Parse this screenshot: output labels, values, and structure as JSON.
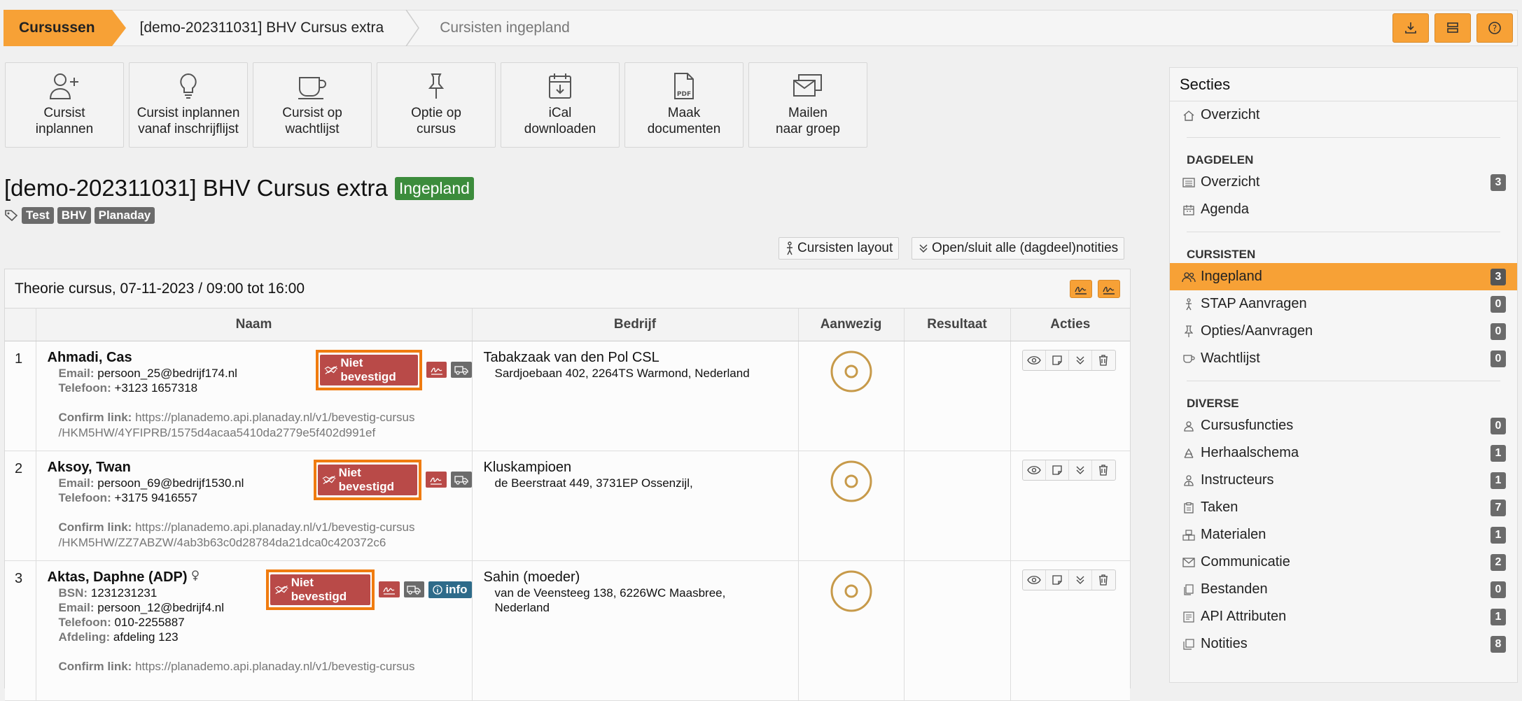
{
  "breadcrumb": {
    "first": "Cursussen",
    "second": "[demo-202311031] BHV Cursus extra",
    "third": "Cursisten ingepland"
  },
  "top_actions": [
    {
      "icon": "download-icon"
    },
    {
      "icon": "layout-icon"
    },
    {
      "icon": "help-icon"
    }
  ],
  "tiles": [
    {
      "label": "Cursist\ninplannen",
      "icon": "add-user-icon"
    },
    {
      "label": "Cursist inplannen\nvanaf inschrijflijst",
      "icon": "lightbulb-icon"
    },
    {
      "label": "Cursist op\nwachtlijst",
      "icon": "coffee-cup-icon"
    },
    {
      "label": "Optie op\ncursus",
      "icon": "pin-icon"
    },
    {
      "label": "iCal\ndownloaden",
      "icon": "calendar-download-icon"
    },
    {
      "label": "Maak\ndocumenten",
      "icon": "pdf-icon"
    },
    {
      "label": "Mailen\nnaar groep",
      "icon": "mail-group-icon"
    }
  ],
  "course": {
    "title": "[demo-202311031] BHV Cursus extra",
    "status": "Ingepland",
    "tags": [
      "Test",
      "BHV",
      "Planaday"
    ]
  },
  "buttons": {
    "layout": "Cursisten layout",
    "toggle_notes": "Open/sluit alle (dagdeel)notities"
  },
  "section": {
    "title": "Theorie cursus, 07-11-2023 / 09:00 tot 16:00",
    "columns": {
      "name": "Naam",
      "company": "Bedrijf",
      "present": "Aanwezig",
      "result": "Resultaat",
      "actions": "Acties"
    },
    "labels": {
      "email": "Email:",
      "phone": "Telefoon:",
      "confirm": "Confirm link:",
      "bsn": "BSN:",
      "department": "Afdeling:"
    },
    "status_label": "Niet bevestigd",
    "info_label": "info",
    "rows": [
      {
        "num": "1",
        "name": "Ahmadi, Cas",
        "email": "persoon_25@bedrijf174.nl",
        "phone": "+3123 1657318",
        "link1": "https://planademo.api.planaday.nl/v1/bevestig-cursus",
        "link2": "/HKM5HW/4YFIPRB/1575d4acaa5410da2779e5f402d991ef",
        "company": "Tabakzaak van den Pol CSL",
        "address": "Sardjoebaan 402, 2264TS Warmond, Nederland"
      },
      {
        "num": "2",
        "name": "Aksoy, Twan",
        "email": "persoon_69@bedrijf1530.nl",
        "phone": "+3175 9416557",
        "link1": "https://planademo.api.planaday.nl/v1/bevestig-cursus",
        "link2": "/HKM5HW/ZZ7ABZW/4ab3b63c0d28784da21dca0c420372c6",
        "company": "Kluskampioen",
        "address": "de Beerstraat 449, 3731EP Ossenzijl,"
      },
      {
        "num": "3",
        "name": "Aktas, Daphne (ADP)",
        "bsn": "1231231231",
        "email": "persoon_12@bedrijf4.nl",
        "phone": "010-2255887",
        "department": "afdeling 123",
        "link1": "https://planademo.api.planaday.nl/v1/bevestig-cursus",
        "company": "Sahin (moeder)",
        "address1": "van de Veensteeg 138, 6226WC Maasbree,",
        "address2": "Nederland"
      }
    ]
  },
  "sidebar": {
    "title": "Secties",
    "overview": "Overzicht",
    "groups": [
      {
        "heading": "DAGDELEN",
        "items": [
          {
            "label": "Overzicht",
            "count": "3",
            "icon": "list-icon"
          },
          {
            "label": "Agenda",
            "icon": "calendar-icon"
          }
        ]
      },
      {
        "heading": "CURSISTEN",
        "items": [
          {
            "label": "Ingepland",
            "count": "3",
            "icon": "users-icon",
            "active": true
          },
          {
            "label": "STAP Aanvragen",
            "count": "0",
            "icon": "walking-icon"
          },
          {
            "label": "Opties/Aanvragen",
            "count": "0",
            "icon": "pin-icon"
          },
          {
            "label": "Wachtlijst",
            "count": "0",
            "icon": "coffee-cup-icon"
          }
        ]
      },
      {
        "heading": "DIVERSE",
        "items": [
          {
            "label": "Cursusfuncties",
            "count": "0",
            "icon": "user-icon"
          },
          {
            "label": "Herhaalschema",
            "count": "1",
            "icon": "recycle-icon"
          },
          {
            "label": "Instructeurs",
            "count": "1",
            "icon": "instructor-icon"
          },
          {
            "label": "Taken",
            "count": "7",
            "icon": "clipboard-icon"
          },
          {
            "label": "Materialen",
            "count": "1",
            "icon": "boxes-icon"
          },
          {
            "label": "Communicatie",
            "count": "2",
            "icon": "envelope-icon"
          },
          {
            "label": "Bestanden",
            "count": "0",
            "icon": "files-icon"
          },
          {
            "label": "API Attributen",
            "count": "1",
            "icon": "api-icon"
          },
          {
            "label": "Notities",
            "count": "8",
            "icon": "notes-icon"
          }
        ]
      }
    ]
  },
  "colors": {
    "accent": "#f7a136",
    "danger": "#b94a48",
    "success": "#3c8c3c",
    "highlight": "#f07c10"
  }
}
